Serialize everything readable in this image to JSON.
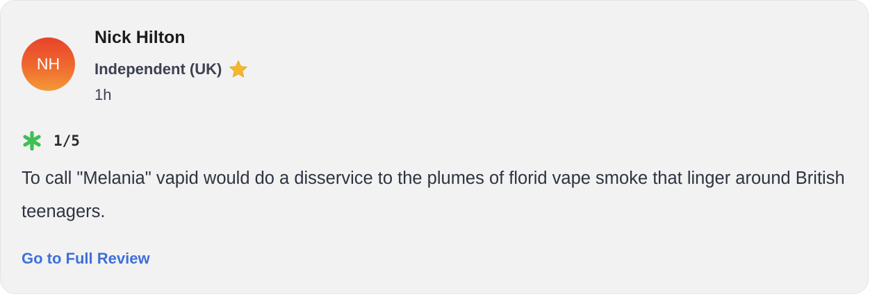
{
  "review": {
    "avatar_initials": "NH",
    "author_name": "Nick Hilton",
    "publication": "Independent (UK)",
    "publication_badge_icon": "star-icon",
    "timestamp": "1h",
    "score_icon": "fresh-splat-icon",
    "score": "1/5",
    "quote": "To call \"Melania\" vapid would do a disservice to the plumes of florid vape smoke that linger around British teenagers.",
    "link_label": "Go to Full Review"
  },
  "colors": {
    "card_background": "#f2f2f2",
    "avatar_gradient_top": "#e8432b",
    "avatar_gradient_bottom": "#f39a36",
    "star": "#f4b82e",
    "score_icon": "#3fbf55",
    "link": "#3f6fd8",
    "body_text": "#2d3340"
  }
}
